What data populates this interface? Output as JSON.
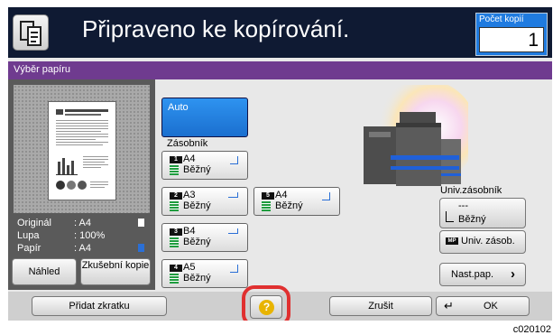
{
  "header": {
    "title": "Připraveno ke kopírování.",
    "copies_label": "Počet kopií",
    "copies_value": "1"
  },
  "panel_title": "Výběr papíru",
  "preview_info": [
    {
      "label": "Originál",
      "value": ": A4"
    },
    {
      "label": "Lupa",
      "value": ": 100%"
    },
    {
      "label": "Papír",
      "value": ": A4"
    }
  ],
  "left_buttons": {
    "preview": "Náhled",
    "test_copy": "Zkušební kopie"
  },
  "auto_label": "Auto",
  "trays_label": "Zásobník",
  "trays": [
    {
      "num": "1",
      "size": "A4",
      "type": "Běžný"
    },
    {
      "num": "2",
      "size": "A3",
      "type": "Běžný"
    },
    {
      "num": "5",
      "size": "A4",
      "type": "Běžný"
    },
    {
      "num": "3",
      "size": "B4",
      "type": "Běžný"
    },
    {
      "num": "4",
      "size": "A5",
      "type": "Běžný"
    }
  ],
  "mp_tray": {
    "title": "Univ.zásobník",
    "size": "---",
    "type": "Běžný",
    "button": "Univ. zásob.",
    "num": "MP"
  },
  "paper_settings": "Nast.pap.",
  "bottom": {
    "add_shortcut": "Přidat zkratku",
    "help": "?",
    "cancel": "Zrušit",
    "ok": "OK"
  },
  "code": "c020102"
}
